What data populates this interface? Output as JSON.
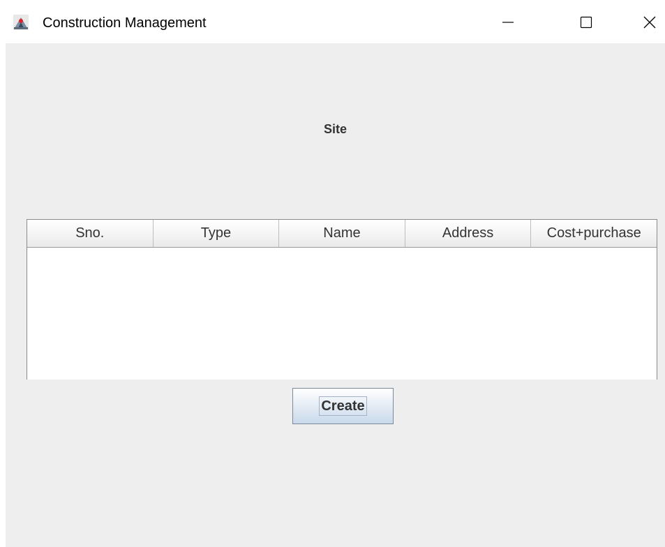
{
  "window": {
    "title": "Construction Management",
    "app_icon": "java-app-icon",
    "controls": {
      "minimize": "minimize-icon",
      "maximize": "maximize-icon",
      "close": "close-icon"
    }
  },
  "main": {
    "heading": "Site",
    "table": {
      "columns": [
        "Sno.",
        "Type",
        "Name",
        "Address",
        "Cost+purchase"
      ],
      "rows": []
    },
    "create_button_label": "Create"
  },
  "colors": {
    "client_background": "#eeeeee",
    "table_background": "#ffffff",
    "button_gradient_bottom": "#c9d9ea"
  }
}
